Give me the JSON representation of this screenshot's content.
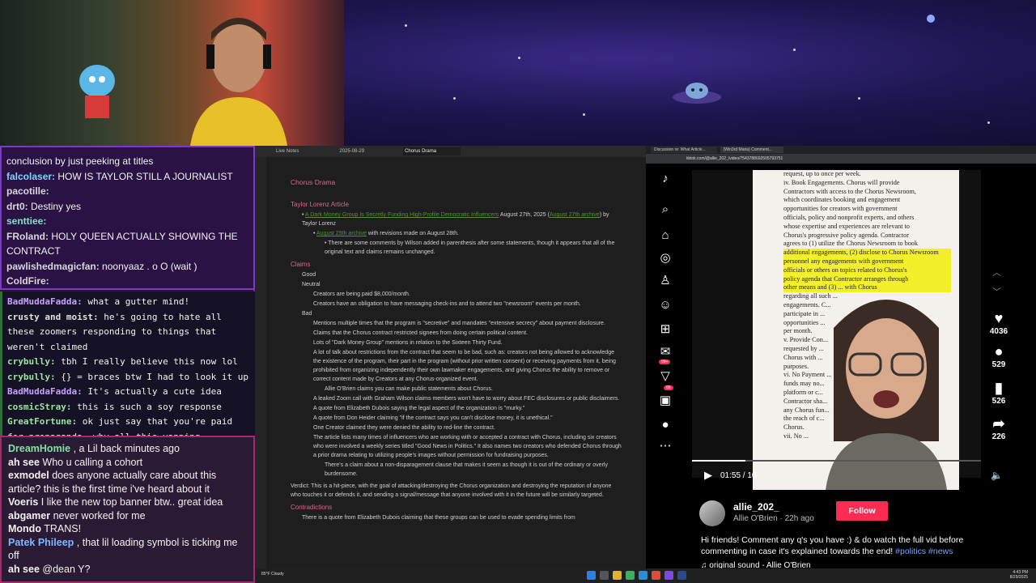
{
  "chat": {
    "top_lines": [
      {
        "user": "",
        "text": "conclusion by just peeking at titles",
        "color": "#f2f2f2"
      },
      {
        "user": "falcolaser:",
        "text": "HOW IS TAYLOR STILL A JOURNALIST",
        "color": "#7fd1ff"
      },
      {
        "user": "pacotille:",
        "text": "",
        "color": "#d8d8d8"
      },
      {
        "user": "drt0:",
        "text": "Destiny yes",
        "color": "#d8d8d8"
      },
      {
        "user": "senttiee:",
        "text": "",
        "color": "#7fe3c8"
      },
      {
        "user": "FRoland:",
        "text": "HOLY QUEEN ACTUALLY SHOWING THE",
        "color": "#d8d8d8"
      },
      {
        "user": "",
        "text": "CONTRACT",
        "color": "#f2f2f2"
      },
      {
        "user": "pawlishedmagicfan:",
        "text": "noonyaaz . o O (wait )",
        "color": "#d8d8d8"
      },
      {
        "user": "ColdFire:",
        "text": "",
        "color": "#d8d8d8"
      }
    ],
    "mid_lines": [
      {
        "user": "BadMuddaFadda:",
        "text": "what a gutter mind!",
        "color": "#c8a0ff"
      },
      {
        "user": "crusty and moist:",
        "text": "he's going to hate all these zoomers responding to things that weren't claimed",
        "color": "#e0e0e0"
      },
      {
        "user": "crybully:",
        "text": "tbh I really believe this now lol",
        "color": "#9be3a0"
      },
      {
        "user": "crybully:",
        "text": "{} = braces btw I had to look it up",
        "color": "#9be3a0"
      },
      {
        "user": "BadMuddaFadda:",
        "text": "It's actually a cute idea",
        "color": "#c8a0ff"
      },
      {
        "user": "cosmicStray:",
        "text": "this is such a soy response",
        "color": "#9be3a0"
      },
      {
        "user": "GreatFortune:",
        "text": "ok just say that you're paid for propaganda, why all this vapping",
        "color": "#9be3a0"
      }
    ],
    "bottom_lines": [
      {
        "user": "DreamHomie",
        "text": ", a Lil back minutes ago",
        "color": "#7fe3a4"
      },
      {
        "user": "ah see",
        "text": "Who u calling a cohort",
        "color": "#f2f2f2"
      },
      {
        "user": "exmodel",
        "text": "does anyone actually care about this article? this is the first time i've heard about it",
        "color": "#f2f2f2"
      },
      {
        "user": "Voeris",
        "text": "I like the new top banner btw.. great idea",
        "color": "#f2f2f2"
      },
      {
        "user": "abgamer",
        "text": "never worked for me",
        "color": "#f2f2f2"
      },
      {
        "user": "Mondo",
        "text": "TRANS!",
        "color": "#f2f2f2"
      },
      {
        "user": "Patek Phileep",
        "text": ", that lil loading symbol is ticking me off",
        "color": "#7fb8ff"
      },
      {
        "user": "ah see",
        "text": "@dean Y?",
        "color": "#f2f2f2"
      }
    ]
  },
  "notes": {
    "tabs": [
      "Live Notes",
      "2025-08-29",
      "Chorus Drama"
    ],
    "title": "Chorus Drama",
    "article_heading": "Taylor Lorenz Article",
    "article_link": "A Dark Money Group Is Secretly Funding High-Profile Democratic Influencers",
    "article_date": "August 27th, 2025 (",
    "archive_link": "August 27th archive",
    "byline": ") by Taylor Lorenz",
    "archive2_link": "August 29th archive",
    "revision": "with revisions made on August 28th.",
    "wilson_note": "There are some comments by Wilson added in parenthesis after some statements, though it appears that all of the original text and claims remains unchanged.",
    "claims_heading": "Claims",
    "good": "Good",
    "neutral": "Neutral",
    "neutral_items": [
      "Creators are being paid $8,000/month.",
      "Creators have an obligation to have messaging check-ins and to attend two \"newsroom\" events per month."
    ],
    "bad": "Bad",
    "bad_items": [
      "Mentions multiple times that the program is \"secretive\" and mandates \"extensive secrecy\" about payment disclosure.",
      "Claims that the Chorus contract restricted signees from doing certain political content.",
      "Lots of \"Dark Money Group\" mentions in relation to the Sixteen Thirty Fund.",
      "A lot of talk about restrictions from the contract that seem to be bad, such as: creators not being allowed to acknowledge the existence of the program, their part in the program (without prior written consent) or receiving payments from it, being prohibited from organizing independently their own lawmaker engagements, and giving Chorus the ability to remove or correct content made by Creators at any Chorus-organized event."
    ],
    "sub_item": "Allie O'Brien claims you can make public statements about Chorus.",
    "bad_items2": [
      "A leaked Zoom call with Graham Wilson claims members won't have to worry about FEC disclosures or public disclaimers.",
      "A quote from Elizabeth Dubois saying the legal aspect of the organization is \"murky.\"",
      "A quote from Don Heider claiming \"if the contract says you can't disclose money, it is unethical.\"",
      "One Creator claimed they were denied the ability to red-line the contract.",
      "The article lists many times of influencers who are working with or accepted a contract with Chorus, including six creators who were involved a weekly series titled \"Good News in Politics.\" It also names two creators who defended Chorus through a prior drama relating to utilizing people's images without permission for fundraising purposes."
    ],
    "sub_item2": "There's a claim about a non-disparagement clause that makes it seem as though it is out of the ordinary or overly burdensome.",
    "verdict": "Verdict: This is a hit-piece, with the goal of attacking/destroying the Chorus organization and destroying the reputation of anyone who touches it or defends it, and sending a signal/message that anyone involved with it in the future will be similarly targeted.",
    "contradictions_heading": "Contradictions",
    "contradiction_1": "There is a quote from Elizabeth Dubois claiming that these groups can be used to evade spending limits from"
  },
  "browser": {
    "tabs": [
      "Discussion re: What Article...",
      "(Win3rd Maria) Comment..."
    ],
    "url": "tiktok.com/@allie_202_/video/7543788692505793751"
  },
  "tiktok": {
    "doc_lines": [
      "request, up to once per week.",
      "iv. Book Engagements. Chorus will provide",
      "Contractors with access to the Chorus Newsroom,",
      "which coordinates booking and engagement",
      "opportunities for creators with government",
      "officials, policy and nonprofit experts, and others",
      "whose expertise and experiences are relevant to",
      "Chorus's progressive policy agenda. Contractor",
      "agrees to (1) utilize the Chorus Newsroom to book",
      "additional engagements, (2) disclose to Chorus Newsroom",
      "personnel any engagements with government",
      "officials or others on topics related to Chorus's",
      "policy agenda that Contractor arranges through",
      "other means and (3) ... with Chorus",
      "regarding all such ...",
      "engagements. C...",
      "participate in ...",
      "opportunities ...",
      "per month.",
      "v. Provide Con...",
      "requested by ...",
      "Chorus with ...",
      "purposes.",
      "vi. No Payment ...",
      "funds may no...",
      "platform or c...",
      "Contractor sha...",
      "any Chorus fun...",
      "the reach of c...",
      "Chorus.",
      "vii. No ..."
    ],
    "time": "01:55 / 10",
    "likes": "4036",
    "comments": "529",
    "saves": "526",
    "shares": "226",
    "username": "allie_202_",
    "display_name": "Allie O'Brien",
    "ago": "22h ago",
    "follow": "Follow",
    "caption": "Hi friends! Comment any q's you have :) & do watch the full vid before commenting in case it's explained towards the end!",
    "tag1": "#politics",
    "tag2": "#news",
    "sound": "original sound - Allie O'Brien",
    "badge_inbox": "99+",
    "badge_activity": "65"
  },
  "taskbar": {
    "weather": "85°F Cloudy",
    "time": "4:43 PM",
    "date": "8/29/2025"
  }
}
